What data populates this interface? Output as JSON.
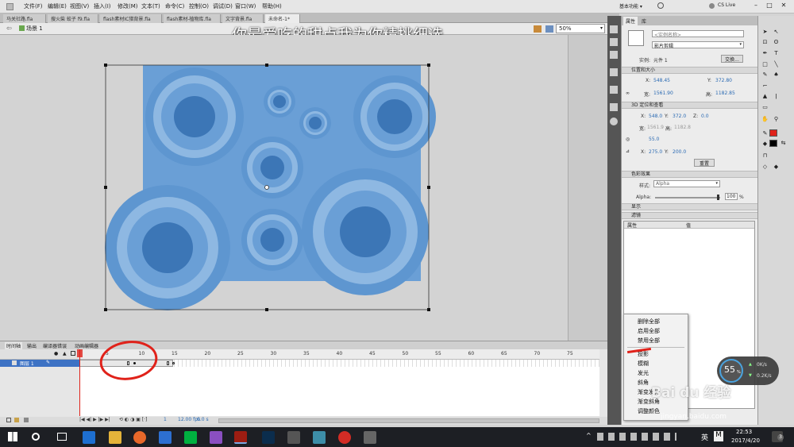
{
  "menubar": {
    "items": [
      "文件(F)",
      "编辑(E)",
      "视图(V)",
      "插入(I)",
      "修改(M)",
      "文本(T)",
      "命令(C)",
      "控制(O)",
      "调试(D)",
      "窗口(W)",
      "帮助(H)"
    ],
    "workspace": "基本功能 ▾",
    "cslive": "CS Live"
  },
  "doc_tabs": [
    "马关社路.fla",
    "搜火柴 蛟子 f9.fla",
    "flash素材IC猎背景.fla",
    "flash素材-植物库.fla",
    "文字背景.fla",
    "未命名-1*"
  ],
  "scene": {
    "label": "场景 1",
    "zoom": "50%"
  },
  "caption": "你最爱吃的甜点我为你精挑细选",
  "timeline": {
    "tabs": [
      "时间轴",
      "输出",
      "编译器错误",
      "动画编辑器"
    ],
    "layer_name": "图层 1",
    "ruler_ticks": [
      "5",
      "10",
      "15",
      "20",
      "25",
      "30",
      "35",
      "40",
      "45",
      "50",
      "55",
      "60",
      "65",
      "70",
      "75"
    ],
    "status": [
      "1",
      "12.00 fps",
      "0.0 s"
    ]
  },
  "properties": {
    "tabs": [
      "属性",
      "库"
    ],
    "instance_name_placeholder": "<实例名称>",
    "type": "影片剪辑",
    "instance_of_label": "实例:",
    "instance_of": "元件 1",
    "swap_button": "交换...",
    "section_position": "位置和大小",
    "x_label": "X:",
    "x": "548.45",
    "y_label": "Y:",
    "y": "372.80",
    "w_label": "宽:",
    "w": "1561.90",
    "h_label": "高:",
    "h": "1182.85",
    "section_3d": "3D 定位和查看",
    "x3d": "548.0",
    "y3d": "372.0",
    "z_label": "Z:",
    "z3d": "0.0",
    "w3d": "1561.9",
    "h3d": "1182.8",
    "persp": "55.0",
    "vx": "275.0",
    "vy": "200.0",
    "reset_button": "重置",
    "section_color": "色彩效果",
    "style_label": "样式:",
    "style": "Alpha",
    "alpha_label": "Alpha:",
    "alpha_value": "100",
    "alpha_unit": "%",
    "section_display": "显示",
    "section_filter": "滤镜",
    "filter_col1": "属性",
    "filter_col2": "值"
  },
  "context_menu": {
    "items": [
      "删除全部",
      "启用全部",
      "禁用全部",
      "投影",
      "模糊",
      "发光",
      "斜角",
      "渐变发光",
      "渐变斜角",
      "调整颜色"
    ]
  },
  "netmeter": {
    "percent": "55",
    "percent_unit": "%",
    "up": "0K/s",
    "down": "0.2K/s"
  },
  "watermark": {
    "brand": "Bai du 经验",
    "url": "jingyan.baidu.com"
  },
  "taskbar": {
    "time": "22:53",
    "date": "2017/4/20",
    "ime": "英",
    "notif_count": "3"
  },
  "colors": {
    "shape_fill": "#6a9fd6",
    "accent_red": "#e0221a",
    "caption": "#ffffff"
  }
}
